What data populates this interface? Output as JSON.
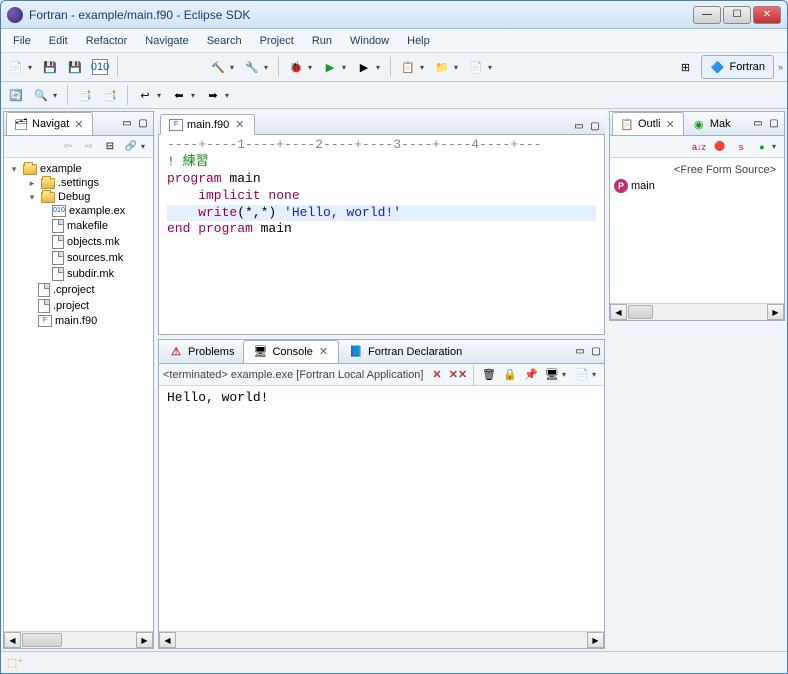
{
  "window": {
    "title": "Fortran - example/main.f90 - Eclipse SDK"
  },
  "menu": {
    "items": [
      "File",
      "Edit",
      "Refactor",
      "Navigate",
      "Search",
      "Project",
      "Run",
      "Window",
      "Help"
    ]
  },
  "perspective": {
    "label": "Fortran"
  },
  "navigator": {
    "tab_label": "Navigat",
    "tree": {
      "root": "example",
      "items": [
        {
          "label": ".settings",
          "type": "folder",
          "indent": 1
        },
        {
          "label": "Debug",
          "type": "folder",
          "indent": 1
        },
        {
          "label": "example.ex",
          "type": "f90",
          "indent": 2
        },
        {
          "label": "makefile",
          "type": "file",
          "indent": 2
        },
        {
          "label": "objects.mk",
          "type": "file",
          "indent": 2
        },
        {
          "label": "sources.mk",
          "type": "file",
          "indent": 2
        },
        {
          "label": "subdir.mk",
          "type": "file",
          "indent": 2
        },
        {
          "label": ".cproject",
          "type": "file",
          "indent": 1
        },
        {
          "label": ".project",
          "type": "file",
          "indent": 1
        },
        {
          "label": "main.f90",
          "type": "f90",
          "indent": 1
        }
      ]
    }
  },
  "editor": {
    "tab_label": "main.f90",
    "ruler": "----+----1----+----2----+----3----+----4----+---",
    "lines": [
      {
        "t": "! 練習",
        "cls": "comment"
      },
      {
        "t": "program",
        "rest": " main",
        "cls": "kw"
      },
      {
        "t": "    implicit none",
        "cls": "kw"
      },
      {
        "t": "    write",
        "mid": "(*,*) ",
        "str": "'Hello, world!'",
        "cls": "kw",
        "hl": true
      },
      {
        "t": "end program",
        "rest": " main",
        "cls": "kw"
      }
    ]
  },
  "outline": {
    "tab1": "Outli",
    "tab2": "Mak",
    "header": "<Free Form Source>",
    "item": "main"
  },
  "bottom": {
    "tabs": {
      "problems": "Problems",
      "console": "Console",
      "fortran_decl": "Fortran Declaration"
    },
    "console": {
      "header": "<terminated> example.exe [Fortran Local Application]",
      "output": "Hello, world!"
    }
  }
}
